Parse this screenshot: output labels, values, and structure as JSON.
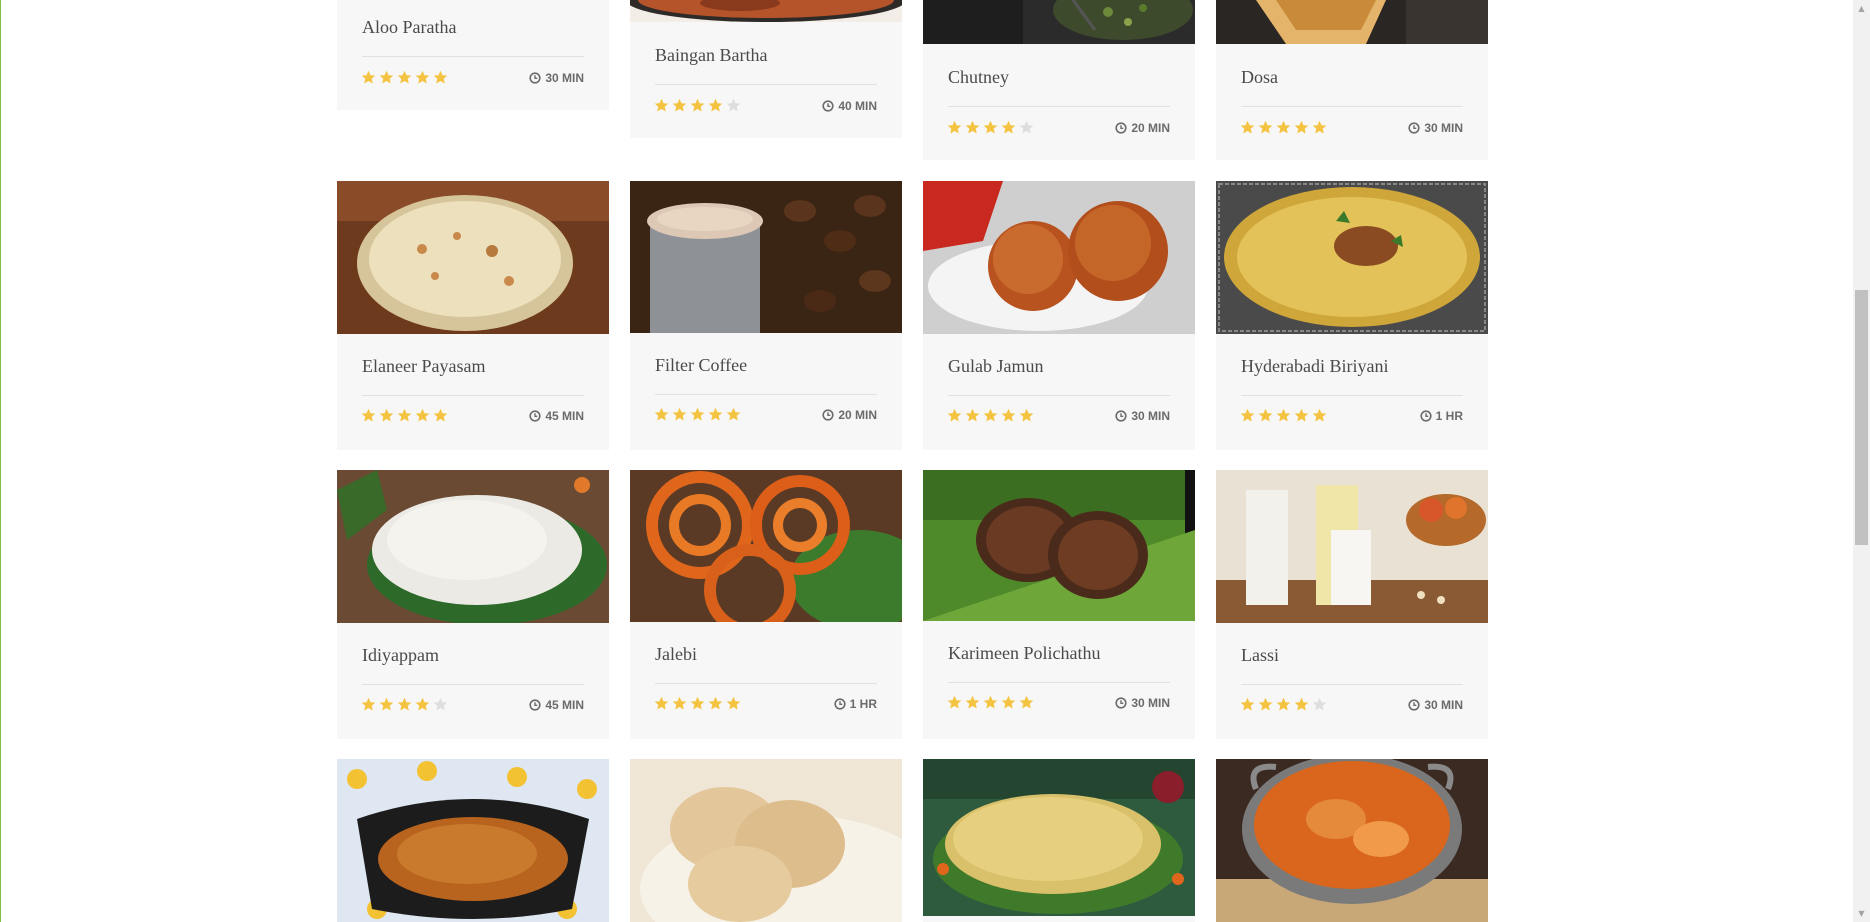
{
  "recipes": [
    {
      "title": "Aloo Paratha",
      "rating": 5,
      "time": "30 MIN"
    },
    {
      "title": "Baingan Bartha",
      "rating": 4,
      "time": "40 MIN"
    },
    {
      "title": "Chutney",
      "rating": 4,
      "time": "20 MIN"
    },
    {
      "title": "Dosa",
      "rating": 5,
      "time": "30 MIN"
    },
    {
      "title": "Elaneer Payasam",
      "rating": 5,
      "time": "45 MIN"
    },
    {
      "title": "Filter Coffee",
      "rating": 5,
      "time": "20 MIN"
    },
    {
      "title": "Gulab Jamun",
      "rating": 5,
      "time": "30 MIN"
    },
    {
      "title": "Hyderabadi Biriyani",
      "rating": 5,
      "time": "1 HR"
    },
    {
      "title": "Idiyappam",
      "rating": 4,
      "time": "45 MIN"
    },
    {
      "title": "Jalebi",
      "rating": 5,
      "time": "1 HR"
    },
    {
      "title": "Karimeen Polichathu",
      "rating": 5,
      "time": "30 MIN"
    },
    {
      "title": "Lassi",
      "rating": 4,
      "time": "30 MIN"
    }
  ],
  "colors": {
    "star_filled": "#f5c342",
    "star_empty": "#dedede",
    "card_bg": "#f7f7f7"
  }
}
